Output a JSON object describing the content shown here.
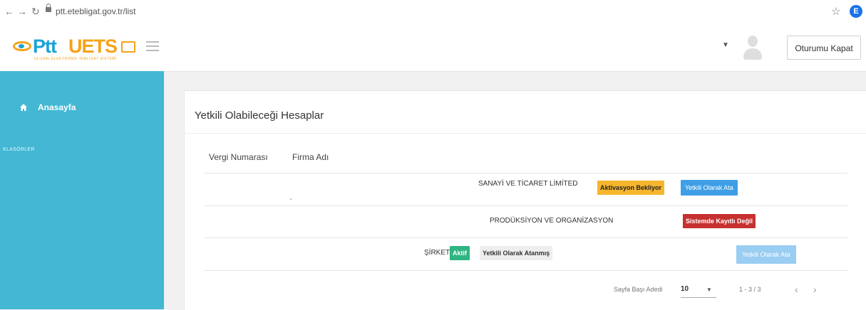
{
  "browser": {
    "url": "ptt.etebligat.gov.tr/list",
    "profile_initial": "E"
  },
  "header": {
    "logo_ptt": "Ptt",
    "logo_uets": "UETS",
    "logo_tagline": "ULUSAL ELEKTRONİK TEBLİGAT SİSTEMİ",
    "logout_label": "Oturumu Kapat"
  },
  "sidebar": {
    "home_label": "Anasayfa",
    "folders_label": "KLASÖRLER"
  },
  "main": {
    "title": "Yetkili Olabileceği Hesaplar",
    "columns": [
      "Vergi Numarası",
      "Firma Adı"
    ],
    "rows": [
      {
        "company": "SANAYİ VE TİCARET LİMİTED",
        "status": "Aktivasyon Bekliyor",
        "action": "Yetkili Olarak Ata"
      },
      {
        "company": "PRODÜKSİYON VE ORGANİZASYON",
        "status": "Sistemde Kayıtlı Değil"
      },
      {
        "company": "ŞİRKETİ",
        "status": "Aktif",
        "authority": "Yetkili Olarak Atanmış",
        "action": "Yetkili Olarak Ata"
      }
    ],
    "pagination": {
      "page_size_label": "Sayfa Başı Adedi",
      "page_size": "10",
      "range": "1 - 3 / 3"
    }
  },
  "colors": {
    "sidebar": "#43b7d3",
    "brand_blue": "#1ba3d6",
    "brand_orange": "#f5a31a",
    "warning": "#f5b52c",
    "primary": "#3f9fe6",
    "danger": "#c73030",
    "success": "#2eb582"
  }
}
